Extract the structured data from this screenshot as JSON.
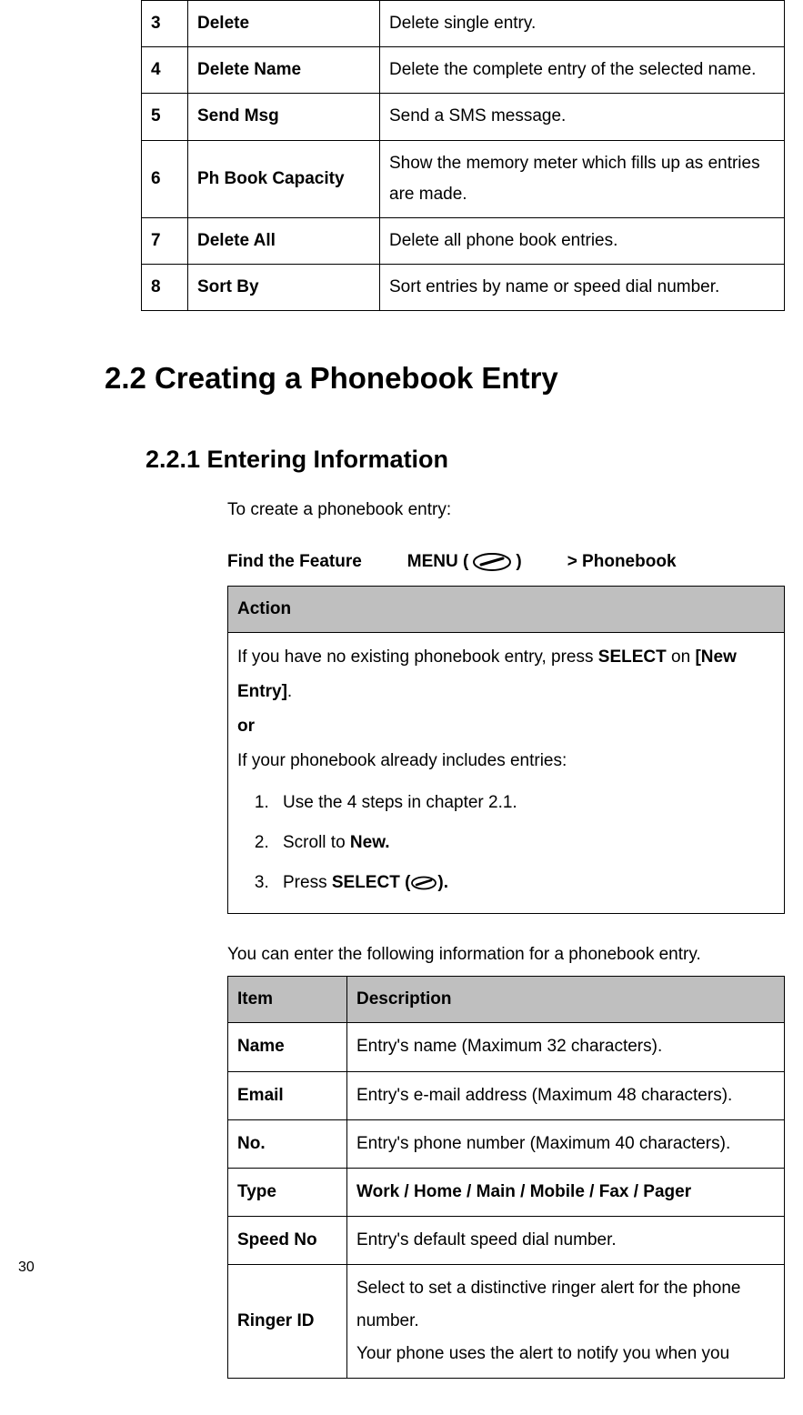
{
  "topTable": {
    "rows": [
      {
        "num": "3",
        "name": "Delete",
        "desc": "Delete single entry."
      },
      {
        "num": "4",
        "name": "Delete Name",
        "desc": "Delete the complete entry of the selected name."
      },
      {
        "num": "5",
        "name": "Send Msg",
        "desc": "Send a SMS message."
      },
      {
        "num": "6",
        "name": "Ph Book Capacity",
        "desc": "Show the memory meter which fills up as entries are made."
      },
      {
        "num": "7",
        "name": "Delete All",
        "desc": "Delete all phone book entries."
      },
      {
        "num": "8",
        "name": "Sort By",
        "desc": "Sort entries by name or speed dial number."
      }
    ]
  },
  "h1": "2.2   Creating a Phonebook Entry",
  "h2": "2.2.1     Entering Information",
  "intro": "To create a phonebook entry:",
  "feature": {
    "find": "Find the Feature",
    "menuPrefix": "MENU (",
    "menuSuffix": ")",
    "path": "> Phonebook"
  },
  "actionTable": {
    "header": "Action",
    "line1a": "If you have no existing phonebook entry, press ",
    "select": "SELECT",
    "line1b": " on ",
    "newEntry": "[New Entry]",
    "period": ".",
    "or": "or",
    "line2": "If your phonebook already includes entries:",
    "step1": "Use the 4 steps in chapter 2.1.",
    "step2a": "Scroll to ",
    "step2b": "New.",
    "step3a": "Press ",
    "step3b": "SELECT (",
    "step3c": ").",
    "li3text": "3."
  },
  "midText": "You can enter the following information for a phonebook entry.",
  "itemTable": {
    "headers": {
      "item": "Item",
      "desc": "Description"
    },
    "rows": [
      {
        "item": "Name",
        "desc": "Entry's name (Maximum 32 characters).",
        "bold": false
      },
      {
        "item": "Email",
        "desc": "Entry's e-mail address (Maximum 48 characters).",
        "bold": false
      },
      {
        "item": "No.",
        "desc": "Entry's phone number (Maximum 40 characters).",
        "bold": false
      },
      {
        "item": "Type",
        "desc": "Work / Home / Main / Mobile / Fax / Pager",
        "bold": true
      },
      {
        "item": "Speed No",
        "desc": "Entry's default speed dial number.",
        "bold": false
      },
      {
        "item": "Ringer ID",
        "desc": "Select to set a distinctive ringer alert for the phone number.\nYour phone uses the alert to notify you when you",
        "bold": false
      }
    ]
  },
  "pageNum": "30"
}
